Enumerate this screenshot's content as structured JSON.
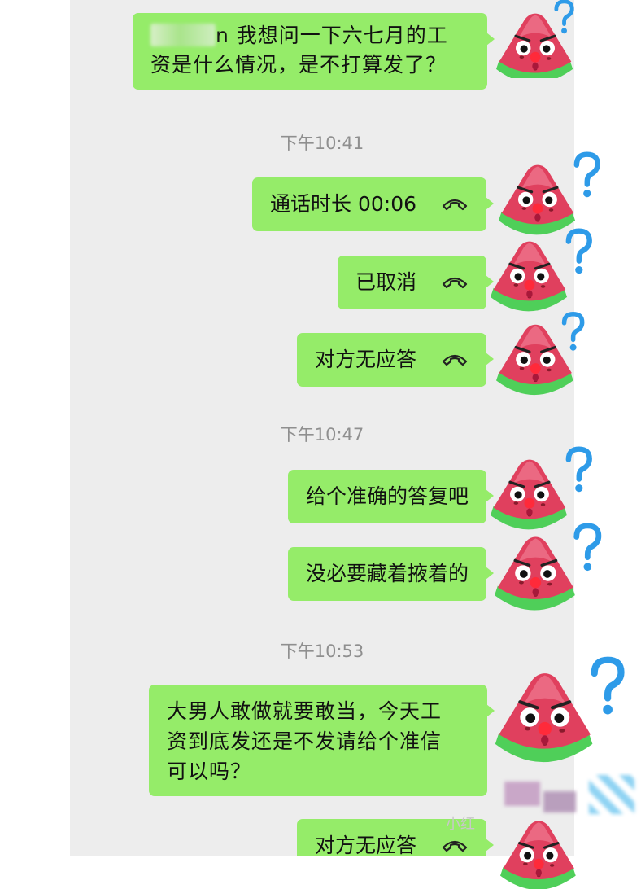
{
  "messages": [
    {
      "text": "我想问一下六七月的工资是什么情况，是不打算发了？",
      "line1_visible": "n 我想问一下六七月的工",
      "line2": "资是什么情况，是不打算发了？"
    },
    {
      "text": "通话时长 00:06",
      "type": "voice-call"
    },
    {
      "text": "已取消",
      "type": "voice-call"
    },
    {
      "text": "对方无应答",
      "type": "voice-call"
    },
    {
      "text": "给个准确的答复吧"
    },
    {
      "text": "没必要藏着掖着的"
    },
    {
      "lines": [
        "大男人敢做就要敢当，今天工",
        "资到底发还是不发请给个准信",
        "可以吗？"
      ]
    },
    {
      "text": "对方无应答",
      "type": "voice-call"
    }
  ],
  "timestamps": [
    "下午10:41",
    "下午10:47",
    "下午10:53"
  ],
  "watermark": "小红",
  "avatar_icon": "watermelon-question-sticker",
  "colors": {
    "bubble": "#95ec69",
    "background": "#ededed",
    "timestamp": "#8f8f8f",
    "watermelon": "#e0405e",
    "rind": "#4fcf59",
    "question_mark": "#2e9be8"
  }
}
